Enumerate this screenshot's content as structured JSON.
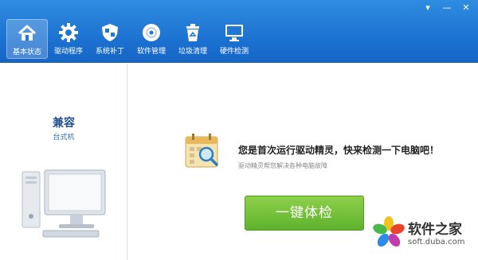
{
  "window": {
    "controls": [
      "▾",
      "—",
      "✕"
    ]
  },
  "nav": {
    "items": [
      {
        "label": "基本状态",
        "icon": "home-icon",
        "active": true
      },
      {
        "label": "驱动程序",
        "icon": "gear-icon",
        "active": false
      },
      {
        "label": "系统补丁",
        "icon": "shield-icon",
        "active": false
      },
      {
        "label": "软件管理",
        "icon": "disc-icon",
        "active": false
      },
      {
        "label": "垃圾清理",
        "icon": "trash-icon",
        "active": false
      },
      {
        "label": "硬件检测",
        "icon": "monitor-icon",
        "active": false
      }
    ]
  },
  "sidebar": {
    "computer_name": "兼容",
    "computer_type": "台式机",
    "illustration": "desktop-pc-icon"
  },
  "main": {
    "icon": "calendar-magnifier-icon",
    "headline": "您是首次运行驱动精灵，快来检测一下电脑吧！",
    "subline": "驱动精灵帮您解决各种电脑故障",
    "scan_button": "一键体检"
  },
  "watermark": {
    "title": "软件之家",
    "url": "soft.duba.com",
    "logo": "flower-logo-icon"
  },
  "colors": {
    "toolbar": "#1a6fcf",
    "accent_green": "#5eb22d",
    "heading_blue": "#1f4e8c"
  }
}
